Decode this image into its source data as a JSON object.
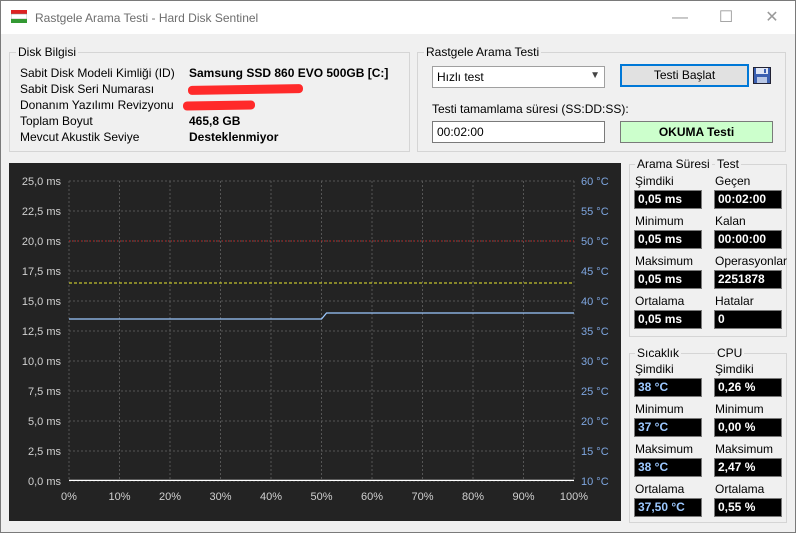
{
  "window": {
    "title": "Rastgele Arama Testi - Hard Disk Sentinel",
    "minimize": "—",
    "maximize": "☐",
    "close": "✕"
  },
  "disk_info": {
    "group_title": "Disk Bilgisi",
    "rows": [
      {
        "label": "Sabit Disk Modeli Kimliği (ID)",
        "value": "Samsung SSD 860 EVO 500GB [C:]"
      },
      {
        "label": "Sabit Disk Seri Numarası",
        "value": ""
      },
      {
        "label": "Donanım Yazılımı Revizyonu",
        "value": ""
      },
      {
        "label": "Toplam Boyut",
        "value": "465,8 GB"
      },
      {
        "label": "Mevcut Akustik Seviye",
        "value": "Desteklenmiyor"
      }
    ]
  },
  "test": {
    "group_title": "Rastgele Arama Testi",
    "mode_selected": "Hızlı test",
    "start_button": "Testi Başlat",
    "duration_label": "Testi tamamlama süresi (SS:DD:SS):",
    "duration_value": "00:02:00",
    "read_button": "OKUMA Testi"
  },
  "stats": {
    "seek_title": "Arama Süresi",
    "test_title": "Test",
    "seek": [
      {
        "label": "Şimdiki",
        "value": "0,05 ms"
      },
      {
        "label": "Minimum",
        "value": "0,05 ms"
      },
      {
        "label": "Maksimum",
        "value": "0,05 ms"
      },
      {
        "label": "Ortalama",
        "value": "0,05 ms"
      }
    ],
    "test": [
      {
        "label": "Geçen",
        "value": "00:02:00"
      },
      {
        "label": "Kalan",
        "value": "00:00:00"
      },
      {
        "label": "Operasyonlar",
        "value": "2251878"
      },
      {
        "label": "Hatalar",
        "value": "0"
      }
    ],
    "temp_title": "Sıcaklık",
    "cpu_title": "CPU",
    "temp": [
      {
        "label": "Şimdiki",
        "value": "38 °C"
      },
      {
        "label": "Minimum",
        "value": "37 °C"
      },
      {
        "label": "Maksimum",
        "value": "38 °C"
      },
      {
        "label": "Ortalama",
        "value": "37,50 °C"
      }
    ],
    "cpu": [
      {
        "label": "Şimdiki",
        "value": "0,26 %"
      },
      {
        "label": "Minimum",
        "value": "0,00 %"
      },
      {
        "label": "Maksimum",
        "value": "2,47 %"
      },
      {
        "label": "Ortalama",
        "value": "0,55 %"
      }
    ]
  },
  "chart_data": {
    "type": "line",
    "x_ticks": [
      "0%",
      "10%",
      "20%",
      "30%",
      "40%",
      "50%",
      "60%",
      "70%",
      "80%",
      "90%",
      "100%"
    ],
    "y_left_ticks": [
      "25,0 ms",
      "22,5 ms",
      "20,0 ms",
      "17,5 ms",
      "15,0 ms",
      "12,5 ms",
      "10,0 ms",
      "7,5 ms",
      "5,0 ms",
      "2,5 ms",
      "0,0 ms"
    ],
    "y_right_ticks": [
      "60 °C",
      "55 °C",
      "50 °C",
      "45 °C",
      "40 °C",
      "35 °C",
      "30 °C",
      "25 °C",
      "20 °C",
      "15 °C",
      "10 °C"
    ],
    "ylim_left": [
      0,
      25
    ],
    "ylim_right": [
      10,
      60
    ],
    "xlim": [
      0,
      100
    ],
    "grid": true,
    "thresholds": [
      {
        "axis": "right",
        "value": 50,
        "color": "#cc2222",
        "style": "dotted"
      },
      {
        "axis": "right",
        "value": 43,
        "color": "#e8e830",
        "style": "dashed"
      }
    ],
    "series": [
      {
        "axis": "right",
        "color": "#9cc8ff",
        "points": [
          [
            0,
            37
          ],
          [
            50,
            37
          ],
          [
            51,
            38
          ],
          [
            100,
            38
          ]
        ]
      },
      {
        "axis": "left",
        "color": "#ffffff",
        "points": [
          [
            0,
            0.05
          ],
          [
            100,
            0.05
          ]
        ]
      }
    ],
    "colors": {
      "background": "#232323",
      "grid": "#555555",
      "left_axis": "#d0d0d0",
      "right_axis": "#7ea6e0",
      "x_axis": "#d0d0d0"
    }
  }
}
